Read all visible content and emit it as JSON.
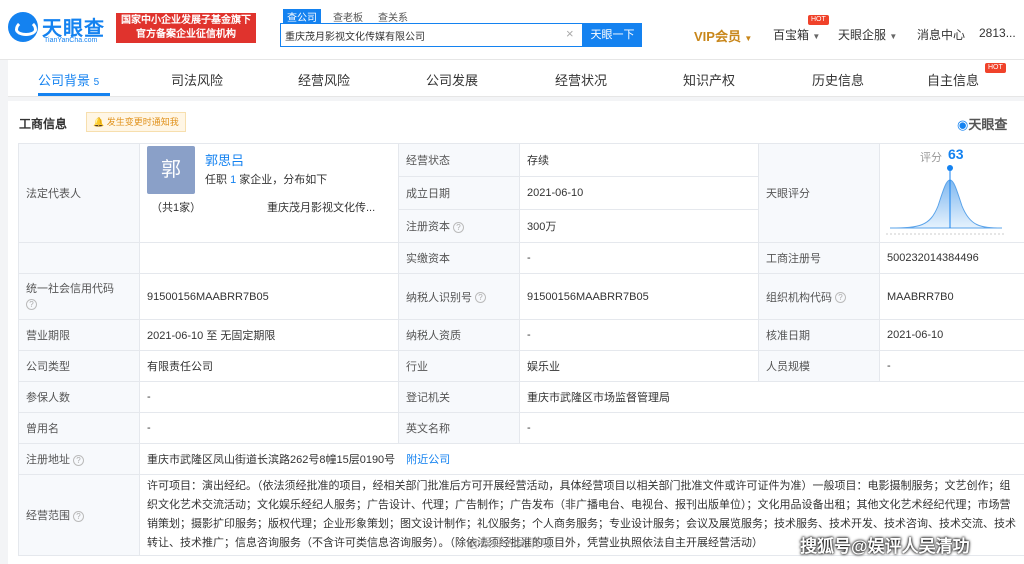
{
  "header": {
    "logo_cn": "天眼查",
    "logo_en": "TianYanCha.com",
    "promo_line1": "国家中小企业发展子基金旗下",
    "promo_line2": "官方备案企业征信机构",
    "search_tabs": [
      "查公司",
      "查老板",
      "查关系"
    ],
    "search_value": "重庆茂月影视文化传媒有限公司",
    "search_clear": "×",
    "search_button": "天眼一下",
    "vip": "VIP会员",
    "baibao": "百宝箱",
    "hot_badge": "HOT",
    "enterprise": "天眼企服",
    "messages": "消息中心",
    "user": "2813..."
  },
  "tabs": {
    "background": "公司背景",
    "background_count": "5",
    "legal": "司法风险",
    "operating_risk": "经营风险",
    "development": "公司发展",
    "operating_status": "经营状况",
    "ip": "知识产权",
    "history": "历史信息",
    "self_risk": "自主信息",
    "hot": "HOT"
  },
  "section": {
    "title": "工商信息",
    "notice": "发生变更时通知我",
    "brand": "天眼查"
  },
  "legal_rep": {
    "label": "法定代表人",
    "avatar": "郭",
    "name": "郭思吕",
    "sub_prefix": "任职",
    "sub_num": "1",
    "sub_suffix": "家企业，分布如下",
    "count": "（共1家）",
    "company": "重庆茂月影视文化传..."
  },
  "rows": {
    "status_label": "经营状态",
    "status_value": "存续",
    "founded_label": "成立日期",
    "founded_value": "2021-06-10",
    "capital_label": "注册资本",
    "capital_value": "300万",
    "paid_label": "实缴资本",
    "paid_value": "-",
    "score_label": "天眼评分",
    "score_text": "评分",
    "score_value": "63",
    "reg_no_label": "工商注册号",
    "reg_no_value": "500232014384496",
    "credit_label": "统一社会信用代码",
    "credit_value": "91500156MAABRR7B05",
    "tax_label": "纳税人识别号",
    "tax_value": "91500156MAABRR7B05",
    "org_label": "组织机构代码",
    "org_value": "MAABRR7B0",
    "term_label": "营业期限",
    "term_value": "2021-06-10  至  无固定期限",
    "taxpayer_label": "纳税人资质",
    "taxpayer_value": "-",
    "approve_label": "核准日期",
    "approve_value": "2021-06-10",
    "type_label": "公司类型",
    "type_value": "有限责任公司",
    "industry_label": "行业",
    "industry_value": "娱乐业",
    "staff_label": "人员规模",
    "staff_value": "-",
    "insured_label": "参保人数",
    "insured_value": "-",
    "authority_label": "登记机关",
    "authority_value": "重庆市武隆区市场监督管理局",
    "former_label": "曾用名",
    "former_value": "-",
    "en_label": "英文名称",
    "en_value": "-",
    "address_label": "注册地址",
    "address_value": "重庆市武隆区凤山街道长滨路262号8幢15层0190号",
    "address_link": "附近公司",
    "scope_label": "经营范围",
    "scope_value": "许可项目：演出经纪。（依法须经批准的项目，经相关部门批准后方可开展经营活动，具体经营项目以相关部门批准文件或许可证件为准）一般项目：电影摄制服务；文艺创作；组织文化艺术交流活动；文化娱乐经纪人服务；广告设计、代理；广告制作；广告发布（非广播电台、电视台、报刊出版单位）；文化用品设备出租；其他文化艺术经纪代理；市场营销策划；摄影扩印服务；版权代理；企业形象策划；图文设计制作；礼仪服务；个人商务服务；专业设计服务；会议及展览服务；技术服务、技术开发、技术咨询、技术交流、技术转让、技术推广；信息咨询服务（不含许可类信息咨询服务）。（除依法须经批准的项目外，凭营业执照依法自主开展经营活动）"
  },
  "watermark": {
    "sohu": "搜狐号@娱评人吴清功",
    "weibo": "@娱评人吴清功"
  },
  "colors": {
    "brand_blue": "#1482f0",
    "promo_red": "#e0332d",
    "vip_gold": "#c8861a"
  }
}
